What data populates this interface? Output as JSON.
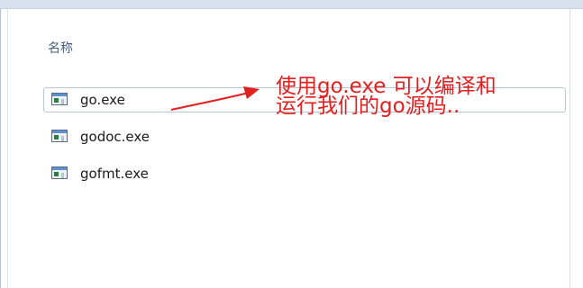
{
  "explorer": {
    "column_header": "名称",
    "files": [
      {
        "name": "go.exe",
        "icon": "exe-icon",
        "focused": true
      },
      {
        "name": "godoc.exe",
        "icon": "exe-icon",
        "focused": false
      },
      {
        "name": "gofmt.exe",
        "icon": "exe-icon",
        "focused": false
      }
    ]
  },
  "annotation": {
    "line1": "使用go.exe 可以编译和",
    "line2": "运行我们的go源码..",
    "color": "#e32020"
  }
}
